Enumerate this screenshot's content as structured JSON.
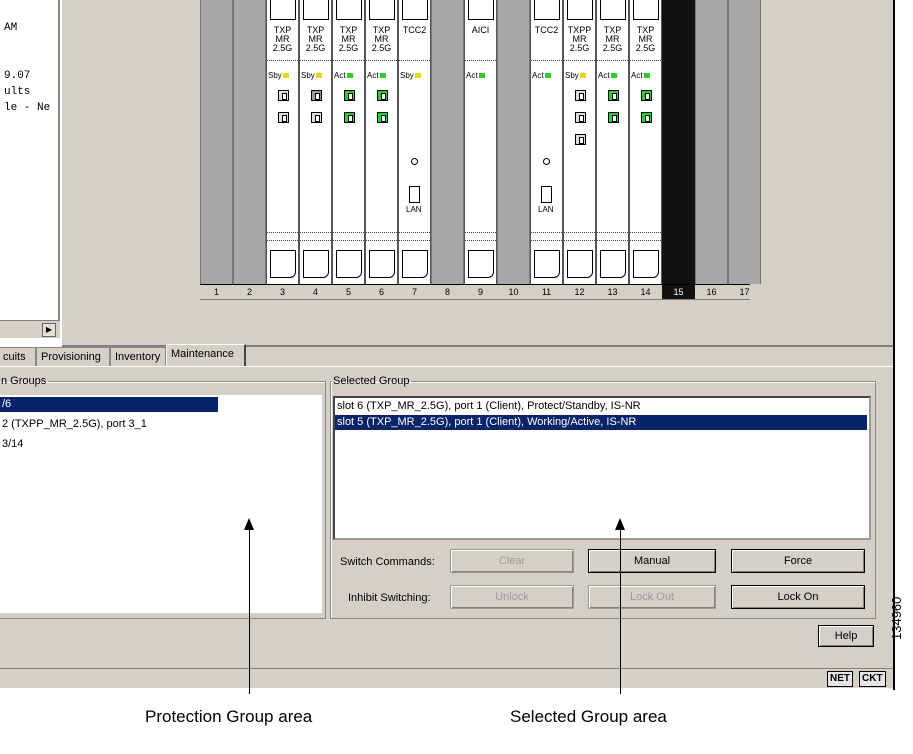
{
  "console_text": [
    "AM",
    "9.07",
    "ults",
    "le - Ne"
  ],
  "cards": [
    {
      "slot": 3,
      "title": [
        "TXP",
        "MR",
        "2.5G"
      ],
      "state": "Sby",
      "led": "#f2d400"
    },
    {
      "slot": 4,
      "title": [
        "TXP",
        "MR",
        "2.5G"
      ],
      "state": "Sby",
      "led": "#f2d400"
    },
    {
      "slot": 5,
      "title": [
        "TXP",
        "MR",
        "2.5G"
      ],
      "state": "Act",
      "led": "#2ecc2e"
    },
    {
      "slot": 6,
      "title": [
        "TXP",
        "MR",
        "2.5G"
      ],
      "state": "Act",
      "led": "#2ecc2e"
    },
    {
      "slot": 7,
      "title": [
        "TCC2"
      ],
      "state": "Sby",
      "led": "#f2d400",
      "lan": "LAN"
    },
    {
      "slot": 9,
      "title": [
        "AICI"
      ],
      "state": "Act",
      "led": "#2ecc2e"
    },
    {
      "slot": 11,
      "title": [
        "TCC2"
      ],
      "state": "Act",
      "led": "#2ecc2e",
      "lan": "LAN"
    },
    {
      "slot": 12,
      "title": [
        "TXPP",
        "MR",
        "2.5G"
      ],
      "state": "Sby",
      "led": "#f2d400"
    },
    {
      "slot": 13,
      "title": [
        "TXP",
        "MR",
        "2.5G"
      ],
      "state": "Act",
      "led": "#2ecc2e"
    },
    {
      "slot": 14,
      "title": [
        "TXP",
        "MR",
        "2.5G"
      ],
      "state": "Act",
      "led": "#2ecc2e"
    }
  ],
  "slot_numbers": [
    "1",
    "2",
    "3",
    "4",
    "5",
    "6",
    "7",
    "8",
    "9",
    "10",
    "11",
    "12",
    "13",
    "14",
    "15",
    "16",
    "17"
  ],
  "selected_slot": "15",
  "tabs": {
    "circuits": "cuits",
    "provisioning": "Provisioning",
    "inventory": "Inventory",
    "maintenance": "Maintenance"
  },
  "protection_groups": {
    "legend": "n Groups",
    "items": [
      "/6",
      "2 (TXPP_MR_2.5G), port 3_1",
      "3/14"
    ]
  },
  "selected_group": {
    "legend": "Selected Group",
    "items": [
      "slot  6 (TXP_MR_2.5G), port 1 (Client), Protect/Standby, IS-NR",
      "slot  5 (TXP_MR_2.5G), port 1 (Client), Working/Active, IS-NR"
    ]
  },
  "switch_commands": {
    "label": "Switch Commands:",
    "clear": "Clear",
    "manual": "Manual",
    "force": "Force"
  },
  "inhibit_switching": {
    "label": "Inhibit Switching:",
    "unlock": "Unlock",
    "lock_out": "Lock Out",
    "lock_on": "Lock On"
  },
  "help_label": "Help",
  "status": {
    "net": "NET",
    "ckt": "CKT"
  },
  "callouts": {
    "protection": "Protection Group area",
    "selected": "Selected Group area"
  },
  "figure_id": "134960"
}
